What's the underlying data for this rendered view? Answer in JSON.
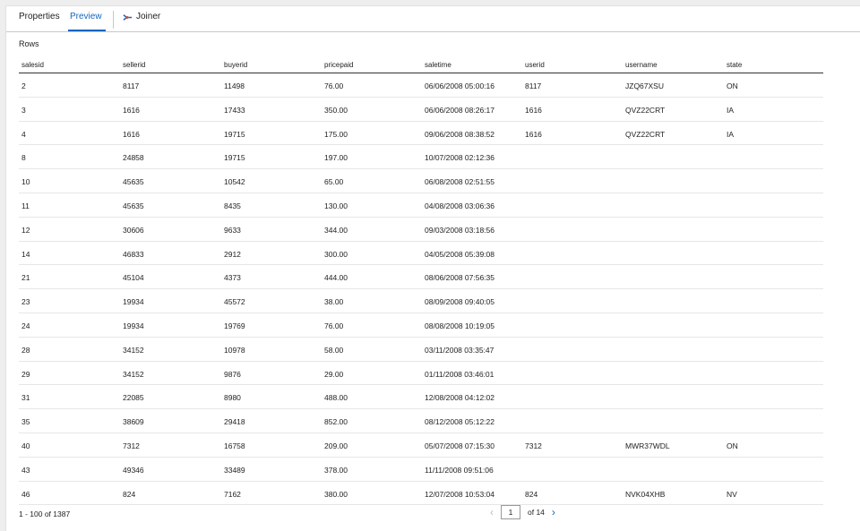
{
  "tabs": {
    "properties": "Properties",
    "preview": "Preview",
    "joiner": "Joiner"
  },
  "rows_label": "Rows",
  "columns": [
    "salesid",
    "sellerid",
    "buyerid",
    "pricepaid",
    "saletime",
    "userid",
    "username",
    "state"
  ],
  "rows": [
    [
      "2",
      "8117",
      "11498",
      "76.00",
      "06/06/2008 05:00:16",
      "8117",
      "JZQ67XSU",
      "ON"
    ],
    [
      "3",
      "1616",
      "17433",
      "350.00",
      "06/06/2008 08:26:17",
      "1616",
      "QVZ22CRT",
      "IA"
    ],
    [
      "4",
      "1616",
      "19715",
      "175.00",
      "09/06/2008 08:38:52",
      "1616",
      "QVZ22CRT",
      "IA"
    ],
    [
      "8",
      "24858",
      "19715",
      "197.00",
      "10/07/2008 02:12:36",
      "",
      "",
      ""
    ],
    [
      "10",
      "45635",
      "10542",
      "65.00",
      "06/08/2008 02:51:55",
      "",
      "",
      ""
    ],
    [
      "11",
      "45635",
      "8435",
      "130.00",
      "04/08/2008 03:06:36",
      "",
      "",
      ""
    ],
    [
      "12",
      "30606",
      "9633",
      "344.00",
      "09/03/2008 03:18:56",
      "",
      "",
      ""
    ],
    [
      "14",
      "46833",
      "2912",
      "300.00",
      "04/05/2008 05:39:08",
      "",
      "",
      ""
    ],
    [
      "21",
      "45104",
      "4373",
      "444.00",
      "08/06/2008 07:56:35",
      "",
      "",
      ""
    ],
    [
      "23",
      "19934",
      "45572",
      "38.00",
      "08/09/2008 09:40:05",
      "",
      "",
      ""
    ],
    [
      "24",
      "19934",
      "19769",
      "76.00",
      "08/08/2008 10:19:05",
      "",
      "",
      ""
    ],
    [
      "28",
      "34152",
      "10978",
      "58.00",
      "03/11/2008 03:35:47",
      "",
      "",
      ""
    ],
    [
      "29",
      "34152",
      "9876",
      "29.00",
      "01/11/2008 03:46:01",
      "",
      "",
      ""
    ],
    [
      "31",
      "22085",
      "8980",
      "488.00",
      "12/08/2008 04:12:02",
      "",
      "",
      ""
    ],
    [
      "35",
      "38609",
      "29418",
      "852.00",
      "08/12/2008 05:12:22",
      "",
      "",
      ""
    ],
    [
      "40",
      "7312",
      "16758",
      "209.00",
      "05/07/2008 07:15:30",
      "7312",
      "MWR37WDL",
      "ON"
    ],
    [
      "43",
      "49346",
      "33489",
      "378.00",
      "11/11/2008 09:51:06",
      "",
      "",
      ""
    ],
    [
      "46",
      "824",
      "7162",
      "380.00",
      "12/07/2008 10:53:04",
      "824",
      "NVK04XHB",
      "NV"
    ]
  ],
  "footer": {
    "range": "1 - 100  of  1387",
    "page": "1",
    "of_label": "of  14",
    "prev_icon": "chevron-left-icon",
    "next_icon": "chevron-right-icon"
  },
  "colors": {
    "accent": "#1565c0",
    "joiner_icon": "#1565c0",
    "joiner_icon_dot": "#e64a19"
  }
}
